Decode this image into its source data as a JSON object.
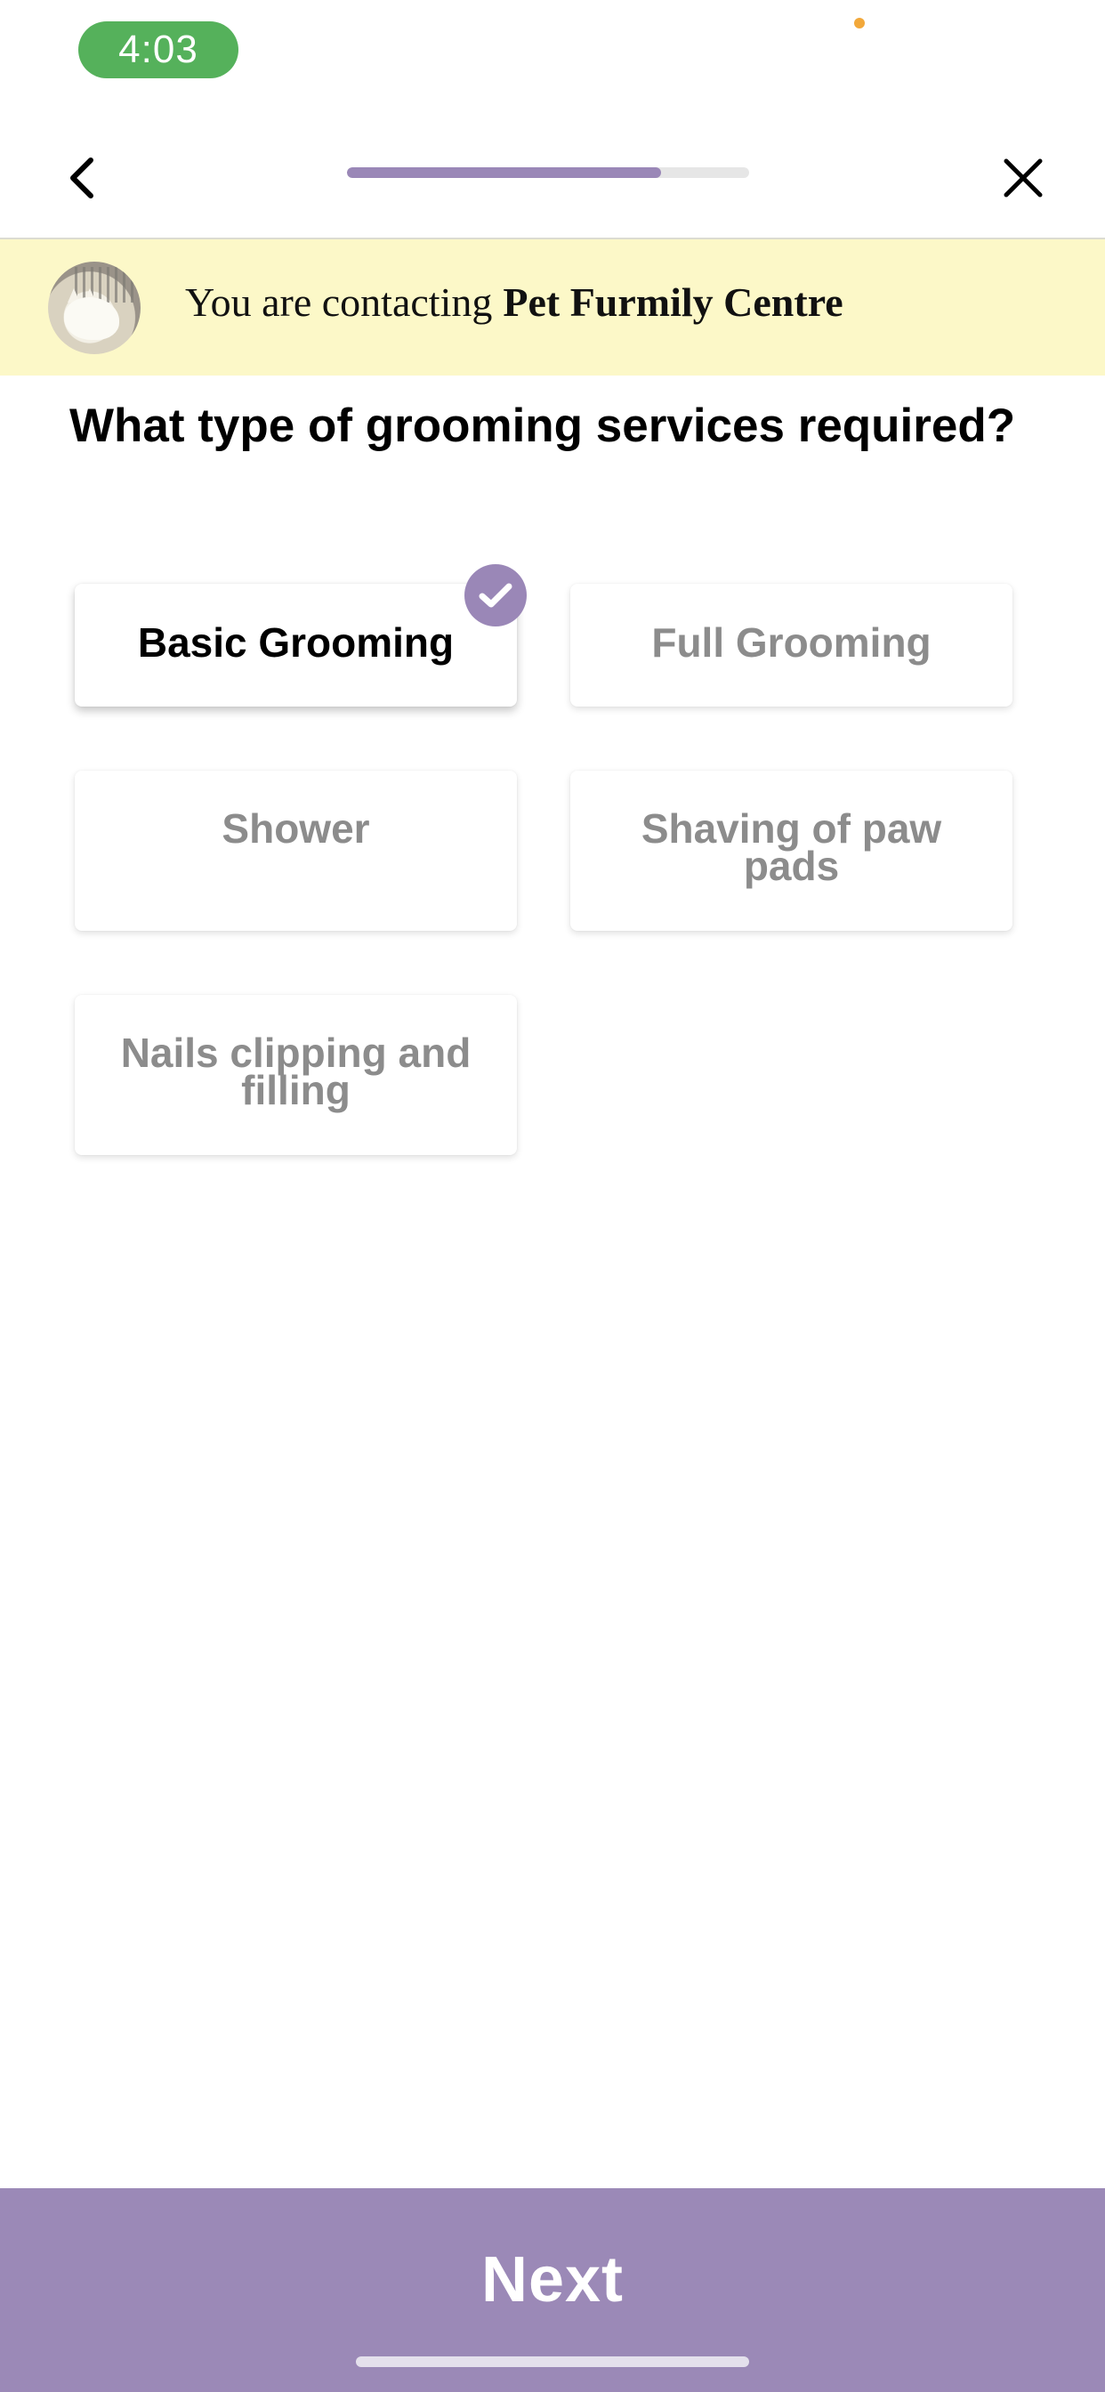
{
  "status_bar": {
    "time": "4:03",
    "time_pill_color": "#55b15b",
    "indicator_dot_color": "#f2a83a"
  },
  "nav": {
    "back_icon": "chevron-left-icon",
    "close_icon": "close-icon",
    "progress_fraction": 0.78,
    "progress_color": "#9a87b7"
  },
  "banner": {
    "prefix": "You are contacting",
    "business_name": "Pet Furmily Centre",
    "background": "#fcf8c8"
  },
  "question": "What type of grooming services required?",
  "options": [
    {
      "label": "Basic Grooming",
      "selected": true
    },
    {
      "label": "Full Grooming",
      "selected": false
    },
    {
      "label": "Shower",
      "selected": false
    },
    {
      "label": "Shaving of paw pads",
      "selected": false
    },
    {
      "label": "Nails clipping and filling",
      "selected": false
    }
  ],
  "selected_check_icon": "check-circle-icon",
  "next_button": {
    "label": "Next",
    "color": "#9b89b7"
  }
}
